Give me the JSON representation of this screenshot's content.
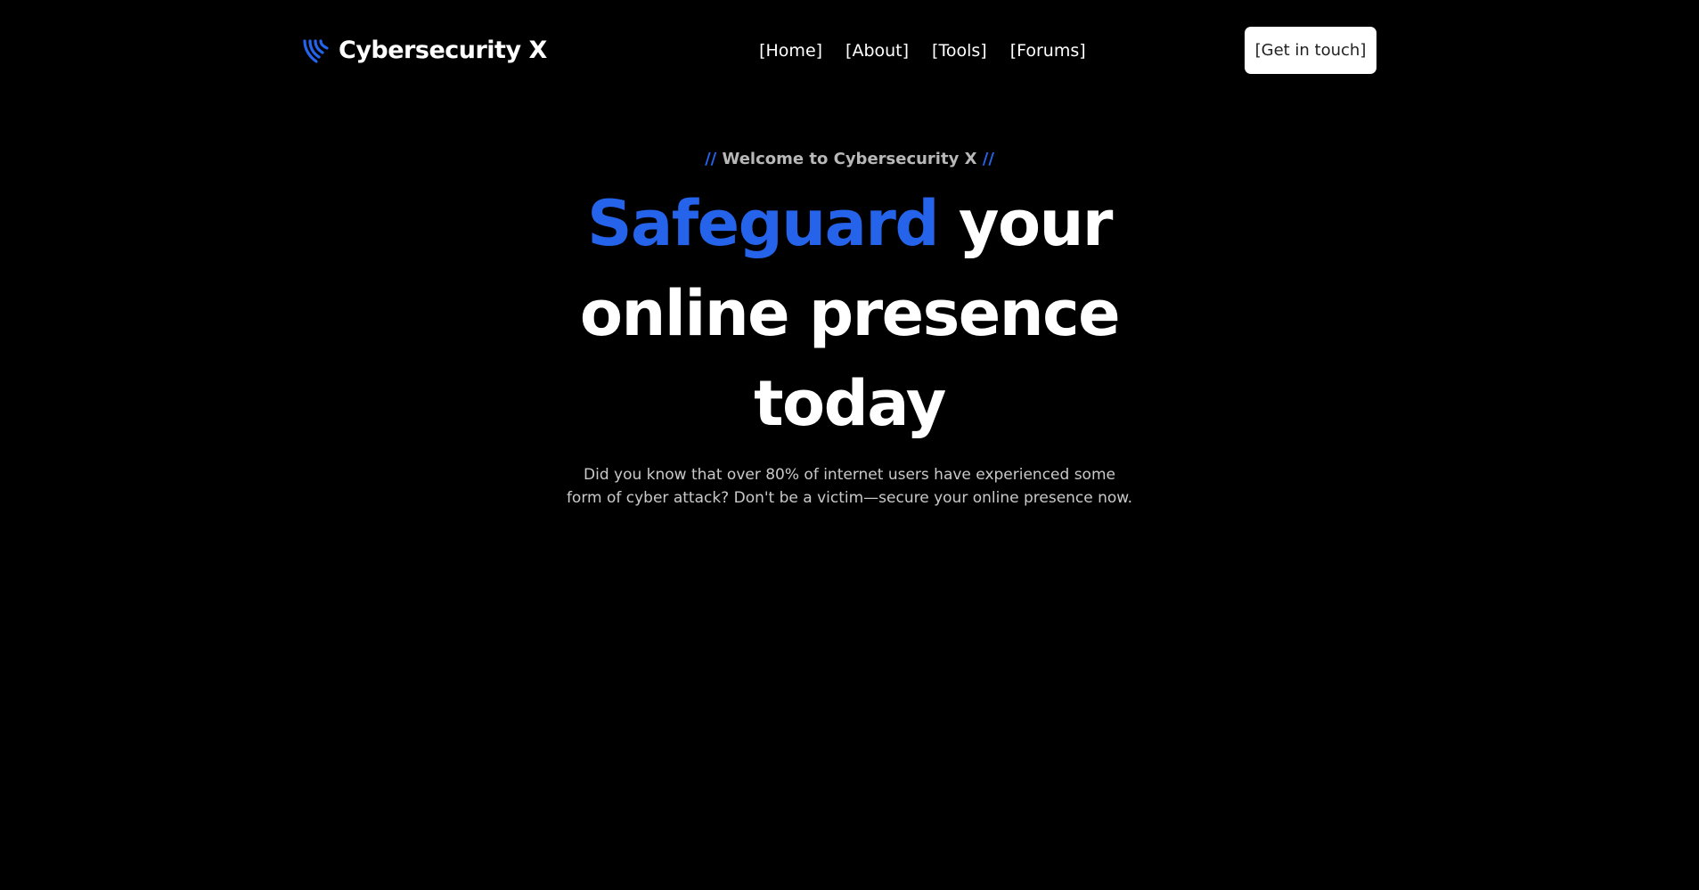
{
  "brand": {
    "name": "Cybersecurity X",
    "logo_icon": "shield-waves-icon",
    "accent_color": "#2563eb"
  },
  "nav": {
    "items": [
      {
        "label": "[Home]"
      },
      {
        "label": "[About]"
      },
      {
        "label": "[Tools]"
      },
      {
        "label": "[Forums]"
      }
    ],
    "cta_label": "[Get in touch]"
  },
  "hero": {
    "eyebrow_prefix": "//",
    "eyebrow_text": "Welcome to Cybersecurity X",
    "eyebrow_suffix": "//",
    "headline_accent": "Safeguard",
    "headline_rest": "your online presence today",
    "description": "Did you know that over 80% of internet users have experienced some form of cyber attack? Don't be a victim—secure your online presence now."
  },
  "colors": {
    "background": "#000000",
    "accent": "#2563eb",
    "text": "#ffffff",
    "muted_text": "#c9c9c9"
  }
}
